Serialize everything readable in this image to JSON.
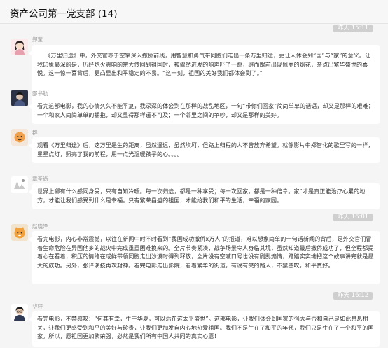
{
  "header": {
    "title": "资产公司第一党支部 (14)"
  },
  "messages": [
    {
      "timestamp": "昨天 15:11",
      "sender": "郑莹",
      "text": "《万里归途》中，外交官亦于空掌深入撤侨前线，用智慧和勇气带同胞们走出一条万里归途，更让人体会到“国”与“家”的意义。让我印象最深的是，历经炮火震响的宗大传回到祖国时，被骤然迸发的响声吓了一跳，继而跟前出现佩丽的烟花，亲点出繁华盛世的喜悦。这一惊一喜背后，更凸显出和平稳定的不易。“这一刻，祖国的美好我们都体会到了。”"
    },
    {
      "sender": "邵书航",
      "text": "看完这部电影，我的心情久久不能平复，我深深的体会到在那样的战乱地区，一句“带你们回家”简简单单的话语，却又是那样的艰难；一个和家人简简单单的拥抱，却又显得那样遥不可及；一个邻里之间的争吵，却又是那样的美好。"
    },
    {
      "sender": "群",
      "text": "观看《万里归途》后，这万里是生的距离，虽然遥远，虽然坎坷，但路上归程的人不曾放弃希望。就像影片中郑智化的歌里写的一样，星星点灯，照亮了我的前程，用一点光温暖孩子的心。。。。"
    },
    {
      "sender": "章圣尚",
      "text": "世界上哪有什么感同身受，只有自知冷暖。每一次归途，都是一种享受；每一次回家，都是一种倍幸。家“才是真正能治疗心累的地方，才能让我们感受到什么是幸福。只有繁荣昌盛的祖国，才能给我们和平的生活，幸福的家园。"
    },
    {
      "timestamp": "昨天 16:01",
      "sender": "赵晓泽",
      "text": "看完电影，内心非常震撼，以往在新闻中时不时看到“我国成功撤侨x万人”的报道，难以想象简单的一句话新闻的背后，是外交官们冒着生命危险在异国他乡的战火中完成重重困难换来的。全片节奏紧凑，战争场景令人身临其境，虽然知道最后撤侨成功了，但全程都提着心在看着，积压的情绪在成鲜带领同胞走出沙漠时得到释放，全片没有空喊口号也没有刷乱煽情，踏踏实实地把这个故事讲完就是最大的成功。另外，张译演技再次封神。看完电影走出影院，看着繁华的街道，有说有笑的路人，不禁感叹，和平真好。"
    },
    {
      "timestamp": "昨天 16:12",
      "sender": "华轩",
      "text": "看完电影，不禁感叹：“何其有幸，生于华夏，可以活在这太平盛世”。这部电影，让我们体会到国家的强大与否和自己是如此息息相关，让我们更感受到和平的美好与珍贵，让我们更加发自内心地热爱祖国。我们不是生在了和平的年代，我们只是生在了一个和平的国家。所以，愿祖国更加繁荣强，必然是我们所有中国人共同的真实心愿！"
    }
  ]
}
